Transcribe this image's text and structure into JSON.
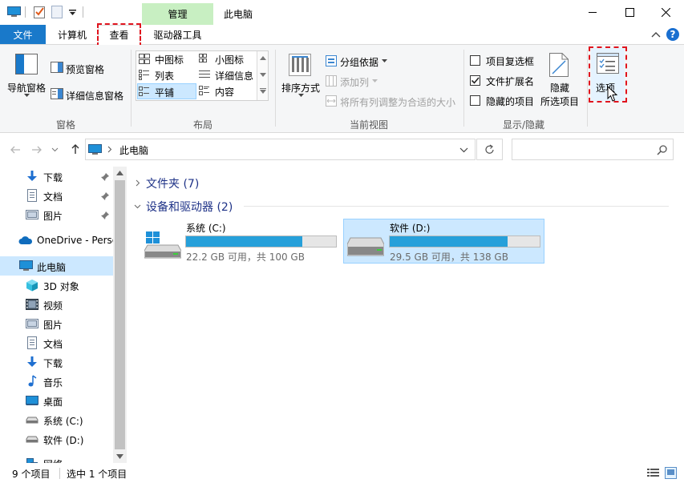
{
  "title_bar": {
    "contextual_tab_group": "管理",
    "window_title": "此电脑"
  },
  "ribbon_tabs": [
    "文件",
    "计算机",
    "查看",
    "驱动器工具"
  ],
  "ribbon": {
    "pane_group": {
      "nav_pane": "导航窗格",
      "preview_pane": "预览窗格",
      "details_pane": "详细信息窗格",
      "name": "窗格"
    },
    "layout_group": {
      "items": [
        "中图标",
        "小图标",
        "列表",
        "详细信息",
        "平铺",
        "内容"
      ],
      "selected": "平铺",
      "name": "布局"
    },
    "current_view_group": {
      "sort_by": "排序方式",
      "group_by": "分组依据",
      "add_columns": "添加列",
      "size_all_columns": "将所有列调整为合适的大小",
      "name": "当前视图"
    },
    "show_hide_group": {
      "item_check_boxes": "项目复选框",
      "file_name_extensions": "文件扩展名",
      "hidden_items": "隐藏的项目",
      "hide_selected_1": "隐藏",
      "hide_selected_2": "所选项目",
      "checked": {
        "item_check_boxes": false,
        "file_name_extensions": true,
        "hidden_items": false
      },
      "name": "显示/隐藏"
    },
    "options_label": "选项"
  },
  "address_bar": {
    "path": "此电脑"
  },
  "nav_pane": {
    "items": [
      {
        "label": "下载",
        "icon": "download-icon",
        "pinned": true
      },
      {
        "label": "文档",
        "icon": "document-icon",
        "pinned": true
      },
      {
        "label": "图片",
        "icon": "pictures-icon",
        "pinned": true
      },
      {
        "label": "OneDrive - Perso",
        "icon": "onedrive-icon"
      },
      {
        "label": "此电脑",
        "icon": "pc-icon",
        "selected": true
      },
      {
        "label": "3D 对象",
        "icon": "3d-objects-icon"
      },
      {
        "label": "视频",
        "icon": "videos-icon"
      },
      {
        "label": "图片",
        "icon": "pictures-icon"
      },
      {
        "label": "文档",
        "icon": "document-icon"
      },
      {
        "label": "下载",
        "icon": "download-icon"
      },
      {
        "label": "音乐",
        "icon": "music-icon"
      },
      {
        "label": "桌面",
        "icon": "desktop-icon"
      },
      {
        "label": "系统 (C:)",
        "icon": "drive-icon"
      },
      {
        "label": "软件 (D:)",
        "icon": "drive-icon"
      },
      {
        "label": "网络",
        "icon": "network-icon"
      }
    ]
  },
  "content": {
    "folders_header": "文件夹 (7)",
    "devices_header": "设备和驱动器 (2)",
    "drives": [
      {
        "name": "系统 (C:)",
        "free_text": "22.2 GB 可用，共 100 GB",
        "used_fraction": 0.778
      },
      {
        "name": "软件 (D:)",
        "free_text": "29.5 GB 可用，共 138 GB",
        "used_fraction": 0.786
      }
    ]
  },
  "status_bar": {
    "item_count": "9 个项目",
    "selected_count": "选中 1 个项目"
  },
  "colors": {
    "file_tab": "#1979ca",
    "manage_tab": "#c8efc2",
    "selection": "#cce8ff",
    "selection_border": "#99d1ff",
    "progress": "#26a0da",
    "highlight": "#e0141e",
    "help": "#1a6fd0"
  }
}
